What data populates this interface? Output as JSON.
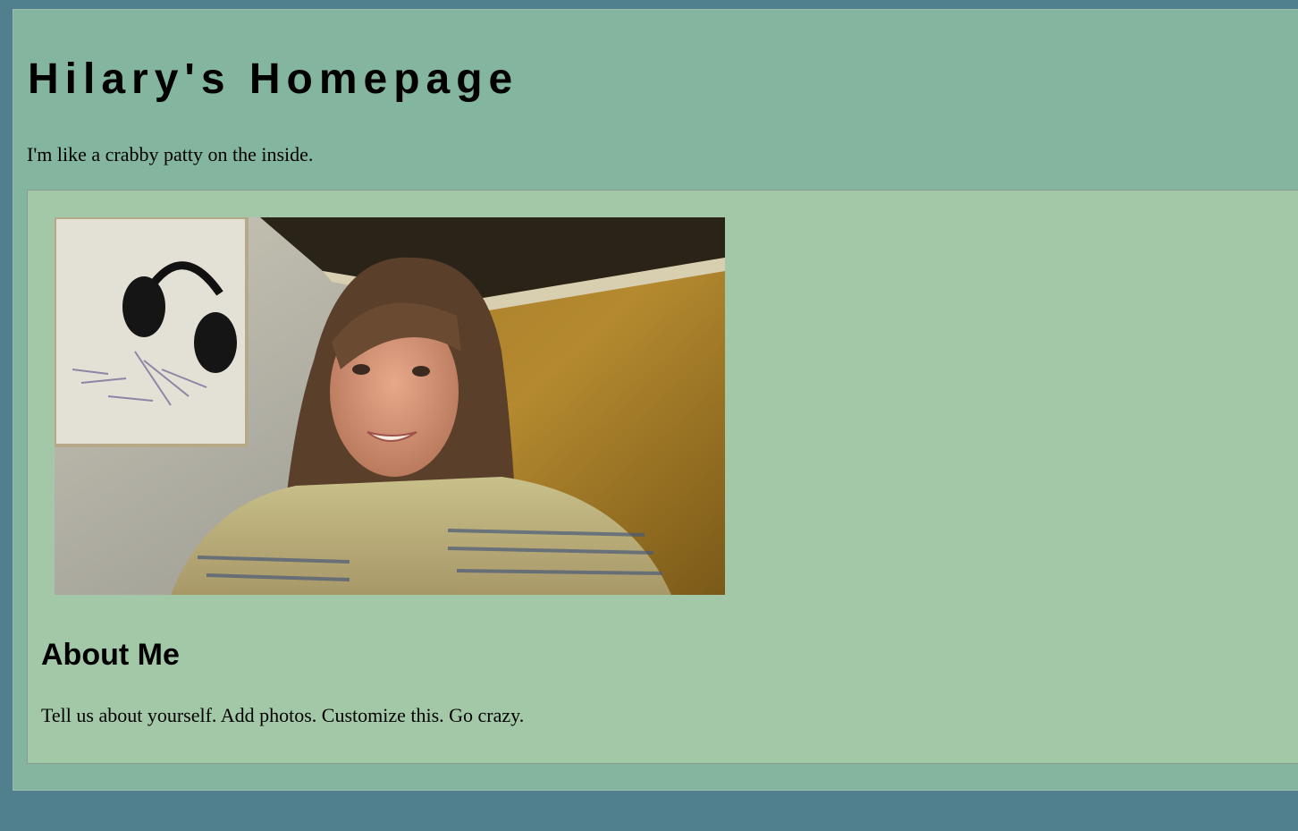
{
  "header": {
    "title": "Hilary's Homepage",
    "tagline": "I'm like a crabby patty on the inside."
  },
  "about": {
    "heading": "About Me",
    "body": "Tell us about yourself. Add photos. Customize this. Go crazy."
  },
  "photo": {
    "alt": "Selfie of a smiling woman with long wavy brown hair, headphones hanging on the wall behind her"
  },
  "colors": {
    "outer_background": "#507f8e",
    "page_background": "#84b59f",
    "content_background": "#a3c8a7",
    "text": "#000000"
  }
}
